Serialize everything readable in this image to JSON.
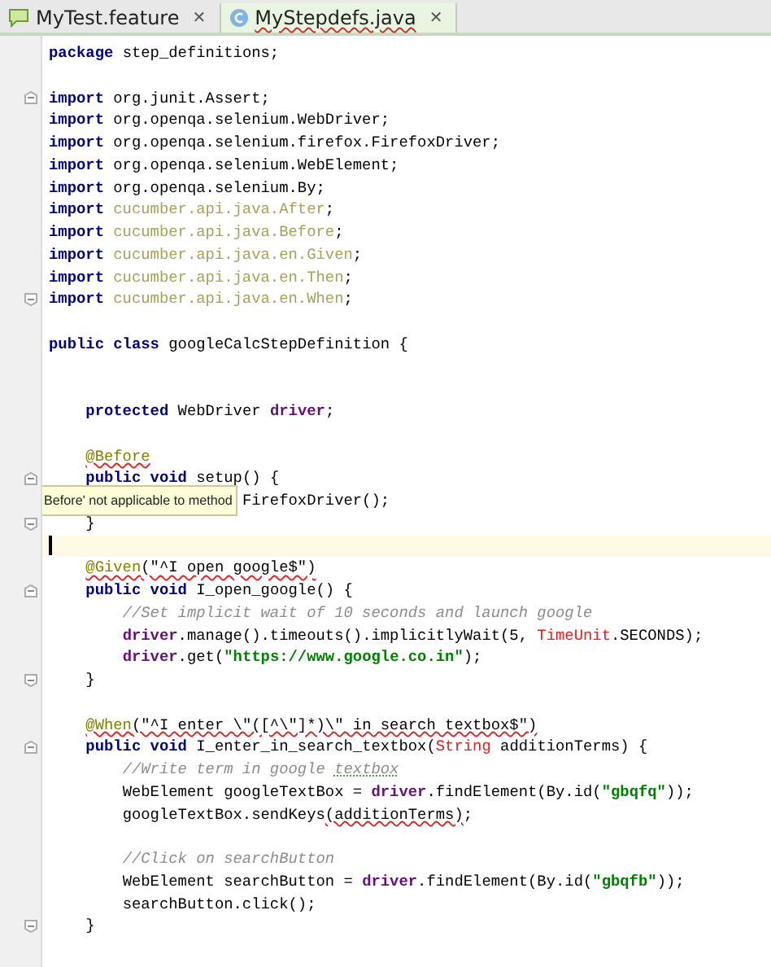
{
  "tabs": [
    {
      "label": "MyTest.feature",
      "kind": "feature",
      "selected": false,
      "error": false,
      "close": "✕"
    },
    {
      "label": "MyStepdefs.java",
      "kind": "class",
      "selected": true,
      "error": true,
      "close": "✕"
    }
  ],
  "lines": [
    {
      "kind": "code",
      "tokens": [
        {
          "t": "package",
          "kind": "keyword"
        },
        {
          "t": " step_definitions;"
        }
      ]
    },
    {
      "kind": "blank"
    },
    {
      "kind": "code",
      "fold_start": true,
      "tokens": [
        {
          "t": "import",
          "kind": "keyword"
        },
        {
          "t": " org.junit.Assert;"
        }
      ]
    },
    {
      "kind": "code",
      "tokens": [
        {
          "t": "import",
          "kind": "keyword"
        },
        {
          "t": " org.openqa.selenium.WebDriver;"
        }
      ]
    },
    {
      "kind": "code",
      "tokens": [
        {
          "t": "import",
          "kind": "keyword"
        },
        {
          "t": " org.openqa.selenium.firefox.FirefoxDriver;"
        }
      ]
    },
    {
      "kind": "code",
      "tokens": [
        {
          "t": "import",
          "kind": "keyword"
        },
        {
          "t": " org.openqa.selenium.WebElement;"
        }
      ]
    },
    {
      "kind": "code",
      "tokens": [
        {
          "t": "import",
          "kind": "keyword"
        },
        {
          "t": " org.openqa.selenium.By;"
        }
      ]
    },
    {
      "kind": "code",
      "tokens": [
        {
          "t": "import",
          "kind": "keyword"
        },
        {
          "t": " cucumber.api.java.After",
          "kind": "unused"
        },
        {
          "t": ";"
        }
      ]
    },
    {
      "kind": "code",
      "tokens": [
        {
          "t": "import",
          "kind": "keyword"
        },
        {
          "t": " cucumber.api.java.Before",
          "kind": "unused"
        },
        {
          "t": ";"
        }
      ]
    },
    {
      "kind": "code",
      "tokens": [
        {
          "t": "import",
          "kind": "keyword"
        },
        {
          "t": " cucumber.api.java.en.Given",
          "kind": "unused"
        },
        {
          "t": ";"
        }
      ]
    },
    {
      "kind": "code",
      "tokens": [
        {
          "t": "import",
          "kind": "keyword"
        },
        {
          "t": " cucumber.api.java.en.Then",
          "kind": "unused"
        },
        {
          "t": ";"
        }
      ]
    },
    {
      "kind": "code",
      "fold_end": true,
      "tokens": [
        {
          "t": "import",
          "kind": "keyword"
        },
        {
          "t": " cucumber.api.java.en.When",
          "kind": "unused"
        },
        {
          "t": ";"
        }
      ]
    },
    {
      "kind": "blank"
    },
    {
      "kind": "code",
      "tokens": [
        {
          "t": "public class",
          "kind": "keyword"
        },
        {
          "t": " googleCalcStepDefinition {"
        }
      ]
    },
    {
      "kind": "blank"
    },
    {
      "kind": "blank"
    },
    {
      "kind": "code",
      "tokens": [
        {
          "t": "    protected",
          "kind": "keyword"
        },
        {
          "t": " WebDriver "
        },
        {
          "t": "driver",
          "kind": "field"
        },
        {
          "t": ";"
        }
      ]
    },
    {
      "kind": "blank"
    },
    {
      "kind": "code",
      "tokens": [
        {
          "t": "    @Before",
          "kind": "annotation",
          "error": true
        }
      ]
    },
    {
      "kind": "code",
      "fold_start": true,
      "tokens": [
        {
          "t": "    public void",
          "kind": "keyword"
        },
        {
          "t": " setup() {"
        }
      ]
    },
    {
      "kind": "code",
      "tooltip": "Before' not applicable to method",
      "tokens": [
        {
          "t": "                     FirefoxDriver();"
        }
      ]
    },
    {
      "kind": "code",
      "fold_end": true,
      "tokens": [
        {
          "t": "    }"
        }
      ]
    },
    {
      "kind": "blank",
      "current": true
    },
    {
      "kind": "code",
      "tokens": [
        {
          "t": "    @Given",
          "kind": "annotation",
          "error": true
        },
        {
          "t": "(\"^I open google$\")",
          "error": true
        }
      ]
    },
    {
      "kind": "code",
      "fold_start": true,
      "tokens": [
        {
          "t": "    public void",
          "kind": "keyword"
        },
        {
          "t": " I_open_google() {"
        }
      ]
    },
    {
      "kind": "code",
      "tokens": [
        {
          "t": "        //Set implicit wait of 10 seconds and launch google",
          "kind": "comment"
        }
      ]
    },
    {
      "kind": "code",
      "tokens": [
        {
          "t": "        driver",
          "kind": "field"
        },
        {
          "t": ".manage().timeouts().implicitlyWait(5, "
        },
        {
          "t": "TimeUnit",
          "kind": "unresolved"
        },
        {
          "t": ".SECONDS);"
        }
      ]
    },
    {
      "kind": "code",
      "tokens": [
        {
          "t": "        driver",
          "kind": "field"
        },
        {
          "t": ".get("
        },
        {
          "t": "\"https://www.google.co.in\"",
          "kind": "string"
        },
        {
          "t": ");"
        }
      ]
    },
    {
      "kind": "code",
      "fold_end": true,
      "tokens": [
        {
          "t": "    }"
        }
      ]
    },
    {
      "kind": "blank"
    },
    {
      "kind": "code",
      "tokens": [
        {
          "t": "    @When",
          "kind": "annotation",
          "error": true
        },
        {
          "t": "(\"^I enter \\\"([^\\\"]*)\\\" in search textbox$\")",
          "error": true
        }
      ]
    },
    {
      "kind": "code",
      "fold_start": true,
      "tokens": [
        {
          "t": "    public void",
          "kind": "keyword"
        },
        {
          "t": " I_enter_in_search_textbox("
        },
        {
          "t": "String",
          "kind": "unresolved"
        },
        {
          "t": " additionTerms) {"
        }
      ]
    },
    {
      "kind": "code",
      "tokens": [
        {
          "t": "        //Write term in google ",
          "kind": "comment"
        },
        {
          "t": "textbox",
          "kind": "comment",
          "typo": true
        }
      ]
    },
    {
      "kind": "code",
      "tokens": [
        {
          "t": "        WebElement googleTextBox = "
        },
        {
          "t": "driver",
          "kind": "field"
        },
        {
          "t": ".findElement(By.id("
        },
        {
          "t": "\"gbqfq\"",
          "kind": "string"
        },
        {
          "t": "));"
        }
      ]
    },
    {
      "kind": "code",
      "tokens": [
        {
          "t": "        googleTextBox.sendKeys"
        },
        {
          "t": "(additionTerms)",
          "error": true
        },
        {
          "t": ";"
        }
      ]
    },
    {
      "kind": "blank"
    },
    {
      "kind": "code",
      "tokens": [
        {
          "t": "        //Click on searchButton",
          "kind": "comment"
        }
      ]
    },
    {
      "kind": "code",
      "tokens": [
        {
          "t": "        WebElement searchButton = "
        },
        {
          "t": "driver",
          "kind": "field"
        },
        {
          "t": ".findElement(By.id("
        },
        {
          "t": "\"gbqfb\"",
          "kind": "string"
        },
        {
          "t": "));"
        }
      ]
    },
    {
      "kind": "code",
      "tokens": [
        {
          "t": "        searchButton.click();"
        }
      ]
    },
    {
      "kind": "code",
      "fold_end": true,
      "tokens": [
        {
          "t": "    }"
        }
      ]
    }
  ]
}
